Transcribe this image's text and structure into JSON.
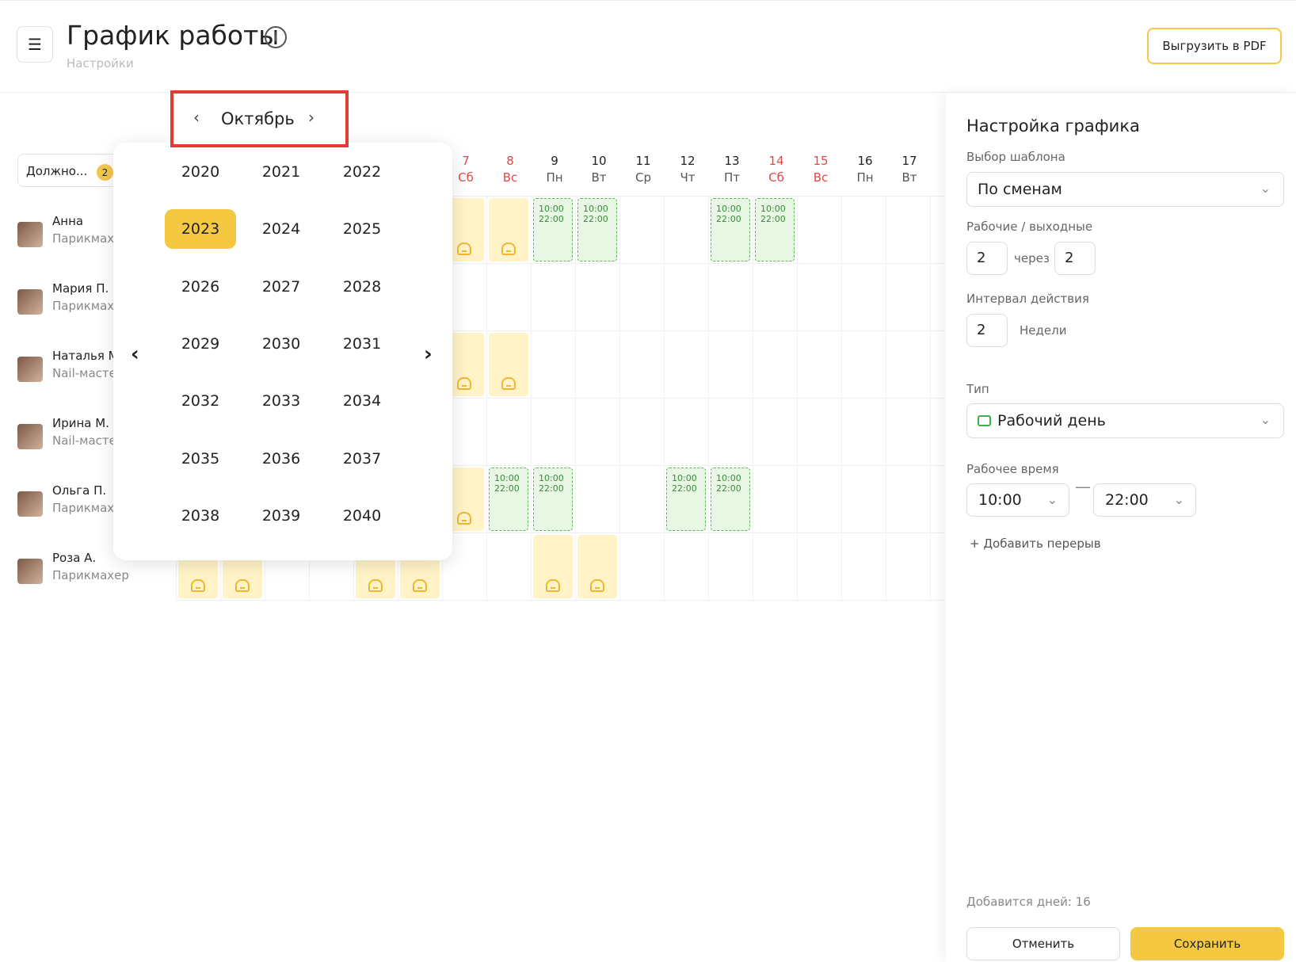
{
  "header": {
    "menu_icon": "menu-icon",
    "title": "График работы",
    "subtitle": "Настройки",
    "pdf_button": "Выгрузить в PDF"
  },
  "filter": {
    "label": "Должно...",
    "badge": "2"
  },
  "month_selector": {
    "month": "Октябрь",
    "prev": "‹",
    "next": "›"
  },
  "year_picker": {
    "years": [
      "2020",
      "2021",
      "2022",
      "2023",
      "2024",
      "2025",
      "2026",
      "2027",
      "2028",
      "2029",
      "2030",
      "2031",
      "2032",
      "2033",
      "2034",
      "2035",
      "2036",
      "2037",
      "2038",
      "2039",
      "2040"
    ],
    "selected": "2023",
    "prev": "‹",
    "next": "›"
  },
  "days": [
    {
      "num": "7",
      "wd": "Сб",
      "weekend": true
    },
    {
      "num": "8",
      "wd": "Вс",
      "weekend": true
    },
    {
      "num": "9",
      "wd": "Пн",
      "weekend": false
    },
    {
      "num": "10",
      "wd": "Вт",
      "weekend": false
    },
    {
      "num": "11",
      "wd": "Ср",
      "weekend": false
    },
    {
      "num": "12",
      "wd": "Чт",
      "weekend": false
    },
    {
      "num": "13",
      "wd": "Пт",
      "weekend": false
    },
    {
      "num": "14",
      "wd": "Сб",
      "weekend": true
    },
    {
      "num": "15",
      "wd": "Вс",
      "weekend": true
    },
    {
      "num": "16",
      "wd": "Пн",
      "weekend": false
    },
    {
      "num": "17",
      "wd": "Вт",
      "weekend": false
    }
  ],
  "employees": [
    {
      "name": "Анна",
      "role": "Парикмах"
    },
    {
      "name": "Мария П.",
      "role": "Парикмах"
    },
    {
      "name": "Наталья М",
      "role": "Nail-масте"
    },
    {
      "name": "Ирина М.",
      "role": "Nail-масте"
    },
    {
      "name": "Ольга П.",
      "role": "Парикмах"
    },
    {
      "name": "Роза А.",
      "role": "Парикмахер"
    }
  ],
  "shift": {
    "start": "10:00",
    "end": "22:00"
  },
  "settings": {
    "title": "Настройка графика",
    "template_label": "Выбор шаблона",
    "template_value": "По сменам",
    "workdays_label": "Рабочие / выходные",
    "work_days": "2",
    "through": "через",
    "off_days": "2",
    "interval_label": "Интервал действия",
    "interval_value": "2",
    "interval_unit": "Недели",
    "type_label": "Тип",
    "type_value": "Рабочий день",
    "worktime_label": "Рабочее время",
    "time_from": "10:00",
    "time_to": "22:00",
    "add_break": "+ Добавить перерыв",
    "days_added": "Добавится дней: 16",
    "cancel": "Отменить",
    "save": "Сохранить"
  }
}
